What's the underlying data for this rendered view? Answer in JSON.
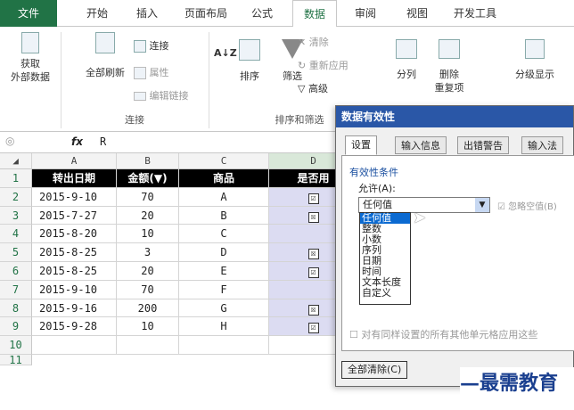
{
  "ribbon": {
    "tabs": [
      "文件",
      "开始",
      "插入",
      "页面布局",
      "公式",
      "数据",
      "审阅",
      "视图",
      "开发工具"
    ],
    "active_tab": "数据",
    "groups": {
      "external_data": "获取\n外部数据",
      "refresh_all": "全部刷新",
      "connections_label": "连接",
      "connections": "连接",
      "properties": "属性",
      "edit_links": "编辑链接",
      "sort_az": "A↓Z",
      "sort": "排序",
      "filter": "筛选",
      "clear": "清除",
      "reapply": "重新应用",
      "advanced": "高级",
      "sort_filter_label": "排序和筛选",
      "text_to_columns": "分列",
      "remove_duplicates": "删除\n重复项",
      "outline": "分级显示"
    }
  },
  "formula_bar": {
    "fx": "fx",
    "value": "R"
  },
  "sheet": {
    "columns": [
      "A",
      "B",
      "C",
      "D"
    ],
    "rows": [
      "1",
      "2",
      "3",
      "4",
      "5",
      "6",
      "7",
      "8",
      "9",
      "10",
      "11"
    ],
    "headers": [
      "转出日期",
      "金额(▼)",
      "商品",
      "是否用"
    ],
    "data": [
      {
        "date": "2015-9-10",
        "amount": "70",
        "item": "A",
        "check": "☑"
      },
      {
        "date": "2015-7-27",
        "amount": "20",
        "item": "B",
        "check": "☒"
      },
      {
        "date": "2015-8-20",
        "amount": "10",
        "item": "C",
        "check": ""
      },
      {
        "date": "2015-8-25",
        "amount": "3",
        "item": "D",
        "check": "☒"
      },
      {
        "date": "2015-8-25",
        "amount": "20",
        "item": "E",
        "check": "☑"
      },
      {
        "date": "2015-9-10",
        "amount": "70",
        "item": "F",
        "check": ""
      },
      {
        "date": "2015-9-16",
        "amount": "200",
        "item": "G",
        "check": "☒"
      },
      {
        "date": "2015-9-28",
        "amount": "10",
        "item": "H",
        "check": "☑"
      }
    ]
  },
  "dialog": {
    "title": "数据有效性",
    "tabs": [
      "设置",
      "输入信息",
      "出错警告",
      "输入法"
    ],
    "section": "有效性条件",
    "allow_label": "允许(A):",
    "allow_value": "任何值",
    "ignore_blank": "忽略空值(B)",
    "options": [
      "任何值",
      "整数",
      "小数",
      "序列",
      "日期",
      "时间",
      "文本长度",
      "自定义"
    ],
    "apply_all": "对有同样设置的所有其他单元格应用这些",
    "clear_all": "全部清除(C)"
  },
  "watermark": "最需教育"
}
